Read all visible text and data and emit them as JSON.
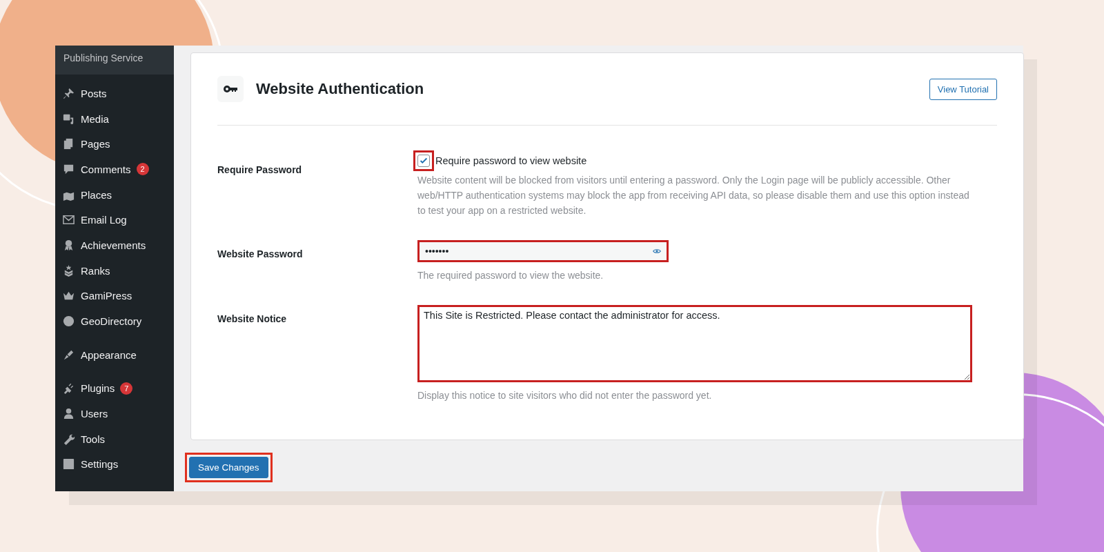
{
  "sidebar": {
    "site_name": "Publishing Service",
    "groups": [
      [
        {
          "label": "Posts"
        },
        {
          "label": "Media"
        },
        {
          "label": "Pages"
        },
        {
          "label": "Comments",
          "badge": "2"
        },
        {
          "label": "Places"
        },
        {
          "label": "Email Log"
        },
        {
          "label": "Achievements"
        },
        {
          "label": "Ranks"
        },
        {
          "label": "GamiPress"
        },
        {
          "label": "GeoDirectory"
        }
      ],
      [
        {
          "label": "Appearance"
        }
      ],
      [
        {
          "label": "Plugins",
          "badge": "7"
        },
        {
          "label": "Users"
        },
        {
          "label": "Tools"
        },
        {
          "label": "Settings"
        }
      ]
    ]
  },
  "panel": {
    "title": "Website Authentication",
    "tutorial_button": "View Tutorial",
    "fields": [
      {
        "kind": "checkbox",
        "label": "Require Password",
        "option": "Require password to view website",
        "checked": true,
        "highlighted": true,
        "help": "Website content will be blocked from visitors until entering a password. Only the Login page will be publicly accessible. Other web/HTTP authentication systems may block the app from receiving API data, so please disable them and use this option instead to test your app on a restricted website."
      },
      {
        "kind": "password",
        "label": "Website Password",
        "value": "•••••••",
        "highlighted": true,
        "help": "The required password to view the website."
      },
      {
        "kind": "textarea",
        "label": "Website Notice",
        "value": "This Site is Restricted. Please contact the administrator for access.",
        "highlighted": true,
        "help": "Display this notice to site visitors who did not enter the password yet."
      }
    ]
  },
  "save_button": {
    "label": "Save Changes",
    "highlighted": true
  }
}
